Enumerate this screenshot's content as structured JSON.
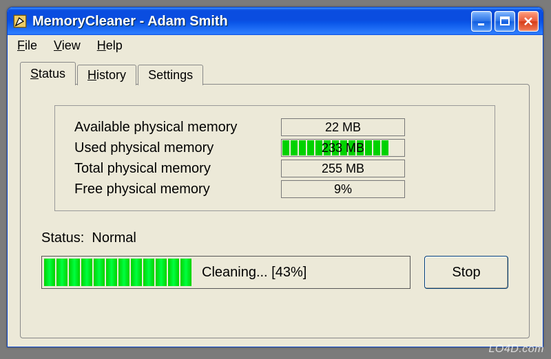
{
  "window": {
    "title": "MemoryCleaner - Adam Smith"
  },
  "menubar": {
    "file": "File",
    "view": "View",
    "help": "Help"
  },
  "tabs": {
    "status": "Status",
    "history": "History",
    "settings": "Settings"
  },
  "stats": {
    "available": {
      "label": "Available physical memory",
      "value": "22 MB"
    },
    "used": {
      "label": "Used physical memory",
      "value": "233 MB",
      "segments": 13
    },
    "total": {
      "label": "Total physical memory",
      "value": "255 MB"
    },
    "free": {
      "label": "Free physical memory",
      "value": "9%"
    }
  },
  "status": {
    "prefix": "Status:",
    "value": "Normal"
  },
  "progress": {
    "text": "Cleaning... [43%]",
    "segments": 12,
    "percent": 43
  },
  "buttons": {
    "stop": "Stop"
  },
  "watermark": "LO4D.com"
}
